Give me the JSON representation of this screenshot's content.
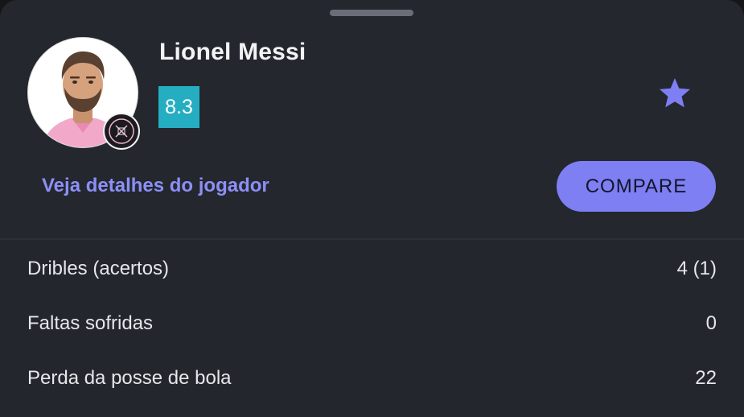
{
  "player": {
    "name": "Lionel Messi",
    "rating": "8.3",
    "details_link": "Veja detalhes do jogador",
    "compare_button": "COMPARE"
  },
  "icons": {
    "favorite": "star-icon",
    "club": "inter-miami-crest-icon"
  },
  "colors": {
    "background": "#24272e",
    "accent": "#7d7ff2",
    "link": "#8c8ff5",
    "rating_badge": "#25aec2"
  },
  "stats": [
    {
      "label": "Dribles (acertos)",
      "value": "4 (1)"
    },
    {
      "label": "Faltas sofridas",
      "value": "0"
    },
    {
      "label": "Perda da posse de bola",
      "value": "22"
    }
  ]
}
